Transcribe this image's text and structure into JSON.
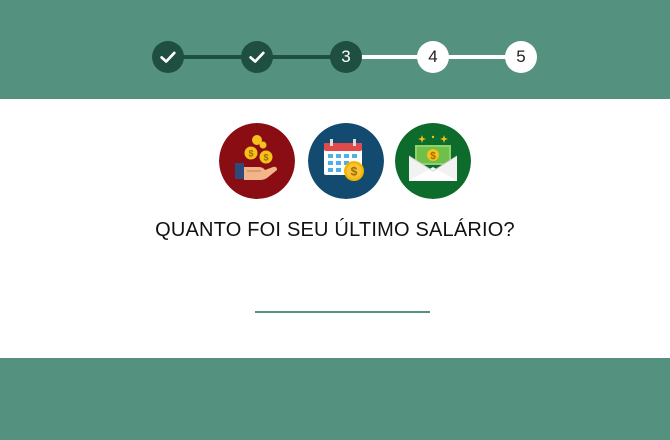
{
  "colors": {
    "band": "#55917f",
    "step_done": "#1f4f41",
    "step_pending": "#ffffff"
  },
  "stepper": {
    "steps": [
      {
        "label": "",
        "state": "complete",
        "icon": "check-icon"
      },
      {
        "label": "",
        "state": "complete",
        "icon": "check-icon"
      },
      {
        "label": "3",
        "state": "current"
      },
      {
        "label": "4",
        "state": "pending"
      },
      {
        "label": "5",
        "state": "pending"
      }
    ]
  },
  "icons": [
    {
      "name": "hand-coins-icon",
      "bg": "#8b0d14"
    },
    {
      "name": "calendar-coin-icon",
      "bg": "#124b6f"
    },
    {
      "name": "money-envelope-icon",
      "bg": "#0d6b2b"
    }
  ],
  "question": {
    "text": "QUANTO FOI SEU ÚLTIMO SALÁRIO?"
  },
  "answer": {
    "value": "",
    "placeholder": ""
  }
}
